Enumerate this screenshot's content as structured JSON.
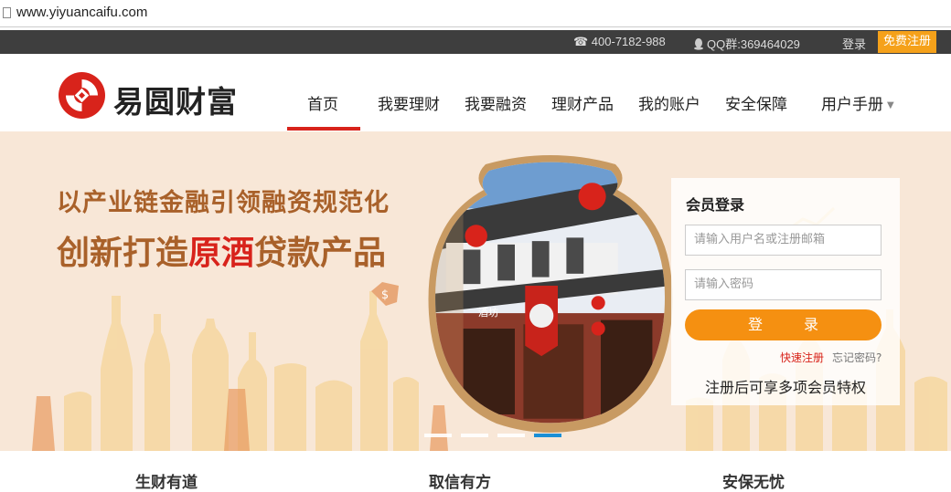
{
  "browser": {
    "url": "www.yiyuancaifu.com"
  },
  "topbar": {
    "phone": "☎ 400-7182-988",
    "qq": "QQ群:369464029",
    "login": "登录",
    "register": "免费注册"
  },
  "header": {
    "logo_text": "易圆财富",
    "nav": [
      "首页",
      "我要理财",
      "我要融资",
      "理财产品",
      "我的账户",
      "安全保障",
      "用户手册"
    ],
    "active_nav": "首页"
  },
  "hero": {
    "slogan_line1": "以产业链金融引领融资规范化",
    "slogan_line2_a": "创新打造",
    "slogan_line2_b": "原酒",
    "slogan_line2_c": "贷款产品",
    "sign_text": "酒坊",
    "active_slide": 4,
    "slide_count": 4
  },
  "login_panel": {
    "title": "会员登录",
    "username_placeholder": "请输入用户名或注册邮箱",
    "password_placeholder": "请输入密码",
    "submit": "登 录",
    "quick_register": "快速注册",
    "forgot_password": "忘记密码?",
    "benefits": "注册后可享多项会员特权"
  },
  "bottom_sections": [
    "生财有道",
    "取信有方",
    "安保无忧"
  ],
  "colors": {
    "brand_red": "#d8231b",
    "accent_orange": "#f59011",
    "topbar": "#3e3e3e",
    "hero_bg": "#f8e7d7"
  }
}
